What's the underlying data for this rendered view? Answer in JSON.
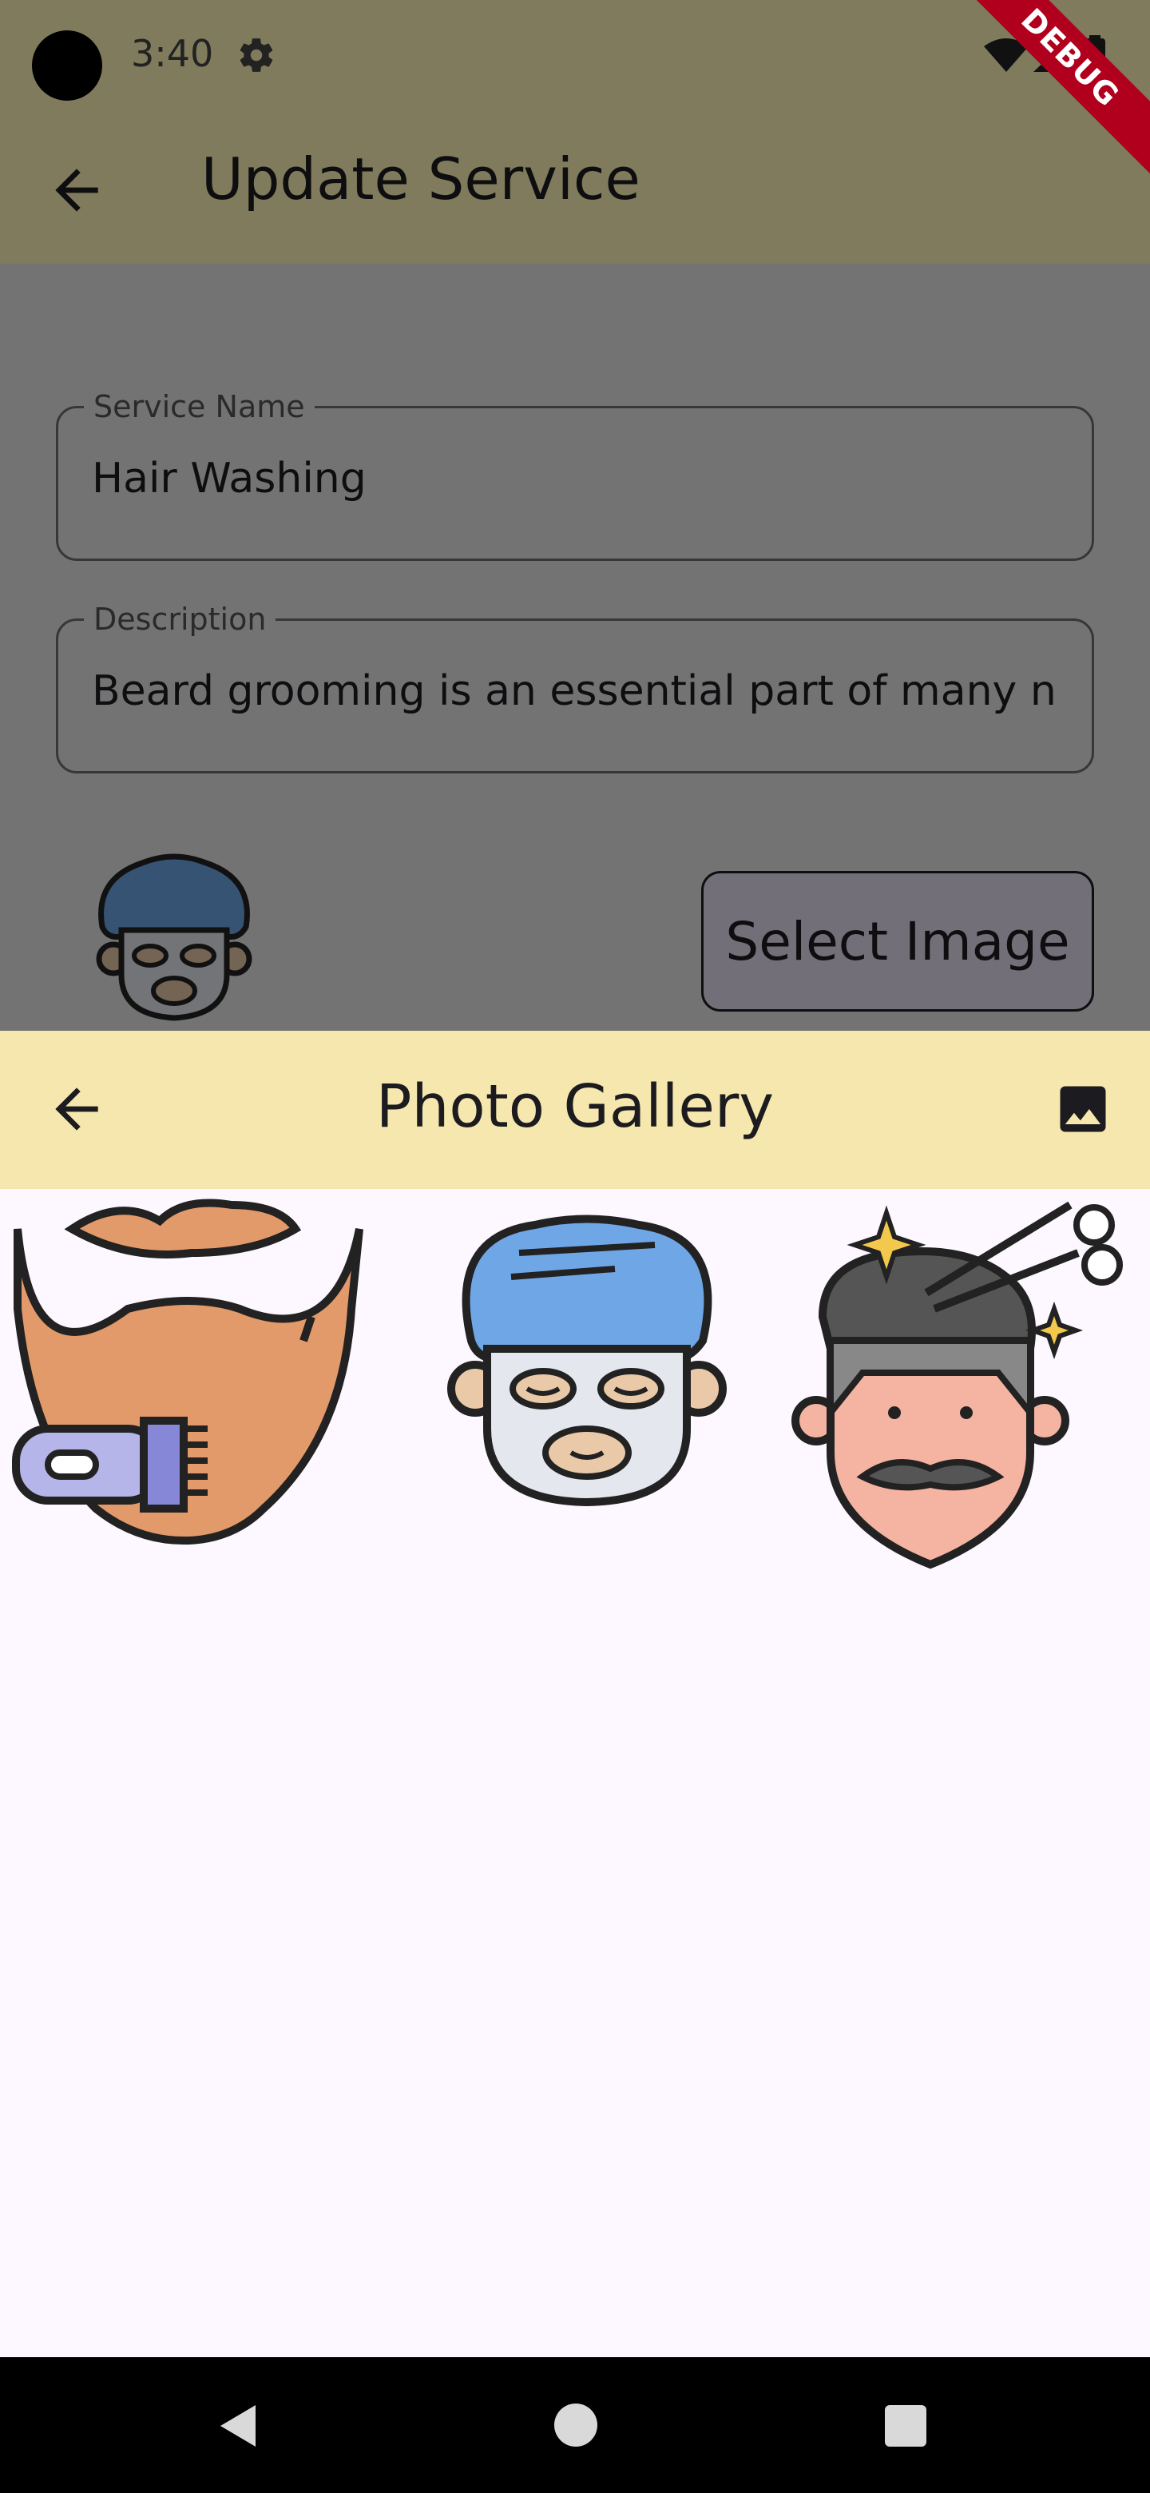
{
  "status_bar": {
    "time": "3:40",
    "icons": [
      "settings-icon",
      "wifi-icon",
      "signal-icon",
      "battery-icon"
    ]
  },
  "app_bar": {
    "title": "Update Service",
    "back_icon": "arrow-back-icon"
  },
  "form": {
    "service_name": {
      "label": "Service Name",
      "value": "Hair Washing"
    },
    "description": {
      "label": "Description",
      "value": "Beard grooming is an essential part of many n"
    },
    "selected_image": "face-mask-turban-icon",
    "select_image_label": "Select Image"
  },
  "gallery_sheet": {
    "title": "Photo Gallery",
    "back_icon": "arrow-back-icon",
    "action_icon": "image-icon",
    "images": [
      {
        "name": "beard-trimmer-icon"
      },
      {
        "name": "face-mask-turban-icon"
      },
      {
        "name": "haircut-man-scissors-icon"
      }
    ]
  },
  "navigation_bar": {
    "buttons": [
      "nav-back-button",
      "nav-home-button",
      "nav-recents-button"
    ]
  },
  "debug_banner": "DEBUG",
  "colors": {
    "app_bar_bg": "#FEF6B8",
    "sheet_header_bg": "#F5E7AD",
    "sheet_bg": "#FDF7FF",
    "select_button_bg": "#E5DEF0",
    "debug_banner_bg": "#B0001E"
  }
}
